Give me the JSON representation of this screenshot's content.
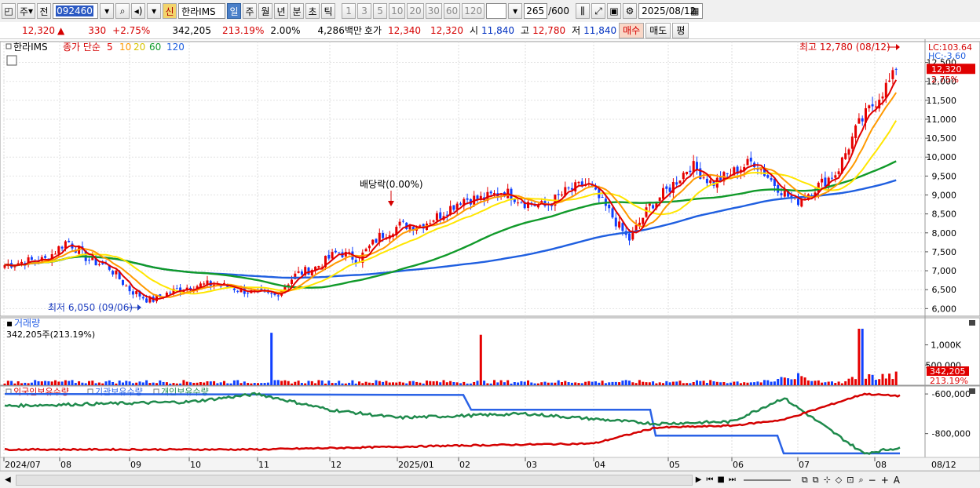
{
  "toolbar": {
    "period_type": "주",
    "prev_label": "전",
    "stock_code": "092460",
    "new_badge": "신",
    "stock_name": "한라IMS",
    "period_buttons": [
      "일",
      "주",
      "월",
      "년",
      "분",
      "초",
      "틱"
    ],
    "active_period": "일",
    "interval_buttons": [
      "1",
      "3",
      "5",
      "10",
      "20",
      "30",
      "60",
      "120"
    ],
    "count_display": "265",
    "count_total": "/600",
    "date": "2025/08/12"
  },
  "quote": {
    "price": "12,320",
    "change_arrow": "▲",
    "change": "330",
    "change_rate": "+2.75%",
    "volume": "342,205",
    "volume_rate": "213.19%",
    "turnover_rate": "2.00%",
    "amount": "4,286백만",
    "bid_label": "호가",
    "ask_price": "12,340",
    "bid_price": "12,320",
    "open_label": "시",
    "open": "11,840",
    "high_label": "고",
    "high": "12,780",
    "low_label": "저",
    "low": "11,840",
    "buy_label": "매수",
    "sell_label": "매도",
    "eval_label": "평"
  },
  "colors": {
    "up": "#e60000",
    "down": "#1040ff",
    "ma5": "#e00000",
    "ma10": "#ff9900",
    "ma20": "#ffe600",
    "ma60": "#119a2a",
    "ma120": "#1f5fe0",
    "foreign": "#d40000",
    "institution": "#2a62e6",
    "individual": "#1f8a4c"
  },
  "price_panel": {
    "stock_label": "한라IMS",
    "legend_prefix": "종가 단순",
    "ma_periods": [
      "5",
      "10",
      "20",
      "60",
      "120"
    ],
    "lc_label": "LC:103.64",
    "hc_label": "HC:-3.60",
    "current_price": "12,320",
    "current_change": "2.75%",
    "high_annotation": "최고 12,780 (08/12)",
    "low_annotation": "최저 6,050 (09/06)",
    "dividend_annotation": "배당락(0.00%)",
    "y_ticks": [
      "12,500",
      "12,000",
      "11,500",
      "11,000",
      "10,500",
      "10,000",
      "9,500",
      "9,000",
      "8,500",
      "8,000",
      "7,500",
      "7,000",
      "6,500",
      "6,000"
    ],
    "ylim": [
      5800,
      13050
    ]
  },
  "volume_panel": {
    "title": "거래량",
    "value_label": "342,205주(213.19%)",
    "y_ticks": [
      "1,000K",
      "500,000"
    ],
    "current_volume": "342,205",
    "current_rate": "213.19%"
  },
  "holdings_panel": {
    "legend": [
      "외국인보유수량",
      "기관보유수량",
      "개인보유수량"
    ],
    "y_ticks": [
      "-600,000",
      "-800,000"
    ]
  },
  "x_axis": {
    "labels": [
      "2024/07",
      "08",
      "09",
      "10",
      "11",
      "12",
      "2025/01",
      "02",
      "03",
      "04",
      "05",
      "06",
      "07",
      "08"
    ],
    "end_label": "08/12"
  },
  "chart_data": {
    "type": "candlestick",
    "series": [
      {
        "name": "5",
        "kind": "moving_average"
      },
      {
        "name": "10",
        "kind": "moving_average"
      },
      {
        "name": "20",
        "kind": "moving_average"
      },
      {
        "name": "60",
        "kind": "moving_average"
      },
      {
        "name": "120",
        "kind": "moving_average"
      }
    ],
    "close_path": [
      [
        "2024/07",
        7150
      ],
      [
        "2024/07 mid",
        7250
      ],
      [
        "2024/07 end",
        7300
      ],
      [
        "2024/08 early",
        7800
      ],
      [
        "2024/08 mid",
        7300
      ],
      [
        "2024/08 late",
        7100
      ],
      [
        "2024/09 early",
        6500
      ],
      [
        "2024/09/06",
        6200
      ],
      [
        "2024/09 mid",
        6450
      ],
      [
        "2024/09 late",
        6600
      ],
      [
        "2024/10 early",
        6650
      ],
      [
        "2024/10 mid",
        6550
      ],
      [
        "2024/10 late",
        6400
      ],
      [
        "2024/11 early",
        6350
      ],
      [
        "2024/11 mid",
        6900
      ],
      [
        "2024/11 late",
        7100
      ],
      [
        "2024/12 early",
        7500
      ],
      [
        "2024/12 mid",
        7300
      ],
      [
        "2024/12 late",
        7900
      ],
      [
        "2025/01 early",
        8200
      ],
      [
        "2025/01 mid",
        8200
      ],
      [
        "2025/01 late",
        8500
      ],
      [
        "2025/02 early",
        8900
      ],
      [
        "2025/02 mid",
        8900
      ],
      [
        "2025/02 late",
        9100
      ],
      [
        "2025/03 early",
        8800
      ],
      [
        "2025/03 mid",
        8700
      ],
      [
        "2025/03 late",
        9100
      ],
      [
        "2025/04 early",
        9300
      ],
      [
        "2025/04 mid",
        8600
      ],
      [
        "2025/04 late",
        7800
      ],
      [
        "2025/05 early",
        8700
      ],
      [
        "2025/05 mid",
        9200
      ],
      [
        "2025/05 late",
        9800
      ],
      [
        "2025/06 early",
        9300
      ],
      [
        "2025/06 mid",
        9600
      ],
      [
        "2025/06 late",
        9900
      ],
      [
        "2025/07 early",
        9300
      ],
      [
        "2025/07 mid",
        8800
      ],
      [
        "2025/07 late",
        9200
      ],
      [
        "2025/08 early",
        9600
      ],
      [
        "2025/08 mid-1",
        10800
      ],
      [
        "2025/08 mid-2",
        11600
      ],
      [
        "2025/08/12",
        12320
      ]
    ],
    "high": 12780,
    "high_date": "08/12",
    "low": 6050,
    "low_date": "09/06",
    "volume_spikes": [
      {
        "position": "2024/11 early",
        "value": 1300000
      },
      {
        "position": "2025/02 early",
        "value": 1250000
      },
      {
        "position": "2025/08 early",
        "value": 1400000
      }
    ],
    "holdings": {
      "foreign": [
        [
          "2024/07",
          -880000
        ],
        [
          "2024/11",
          -880000
        ],
        [
          "2025/02",
          -860000
        ],
        [
          "2025/04",
          -850000
        ],
        [
          "2025/05",
          -770000
        ],
        [
          "2025/06",
          -760000
        ],
        [
          "2025/07",
          -730000
        ],
        [
          "2025/08",
          -600000
        ],
        [
          "2025/08/12",
          -610000
        ]
      ],
      "institution": [
        [
          "2024/07",
          -600000
        ],
        [
          "2025/02",
          -605000
        ],
        [
          "2025/02 mid",
          -680000
        ],
        [
          "2025/04 late",
          -680000
        ],
        [
          "2025/05",
          -810000
        ],
        [
          "2025/06 late",
          -810000
        ],
        [
          "2025/07",
          -900000
        ],
        [
          "2025/08/12",
          -900000
        ]
      ],
      "individual": [
        [
          "2024/07",
          -660000
        ],
        [
          "2024/10",
          -640000
        ],
        [
          "2024/11",
          -600000
        ],
        [
          "2024/12",
          -680000
        ],
        [
          "2025/01",
          -720000
        ],
        [
          "2025/03",
          -700000
        ],
        [
          "2025/05",
          -750000
        ],
        [
          "2025/06",
          -740000
        ],
        [
          "2025/07",
          -620000
        ],
        [
          "2025/08",
          -900000
        ],
        [
          "2025/08/12",
          -870000
        ]
      ]
    }
  }
}
